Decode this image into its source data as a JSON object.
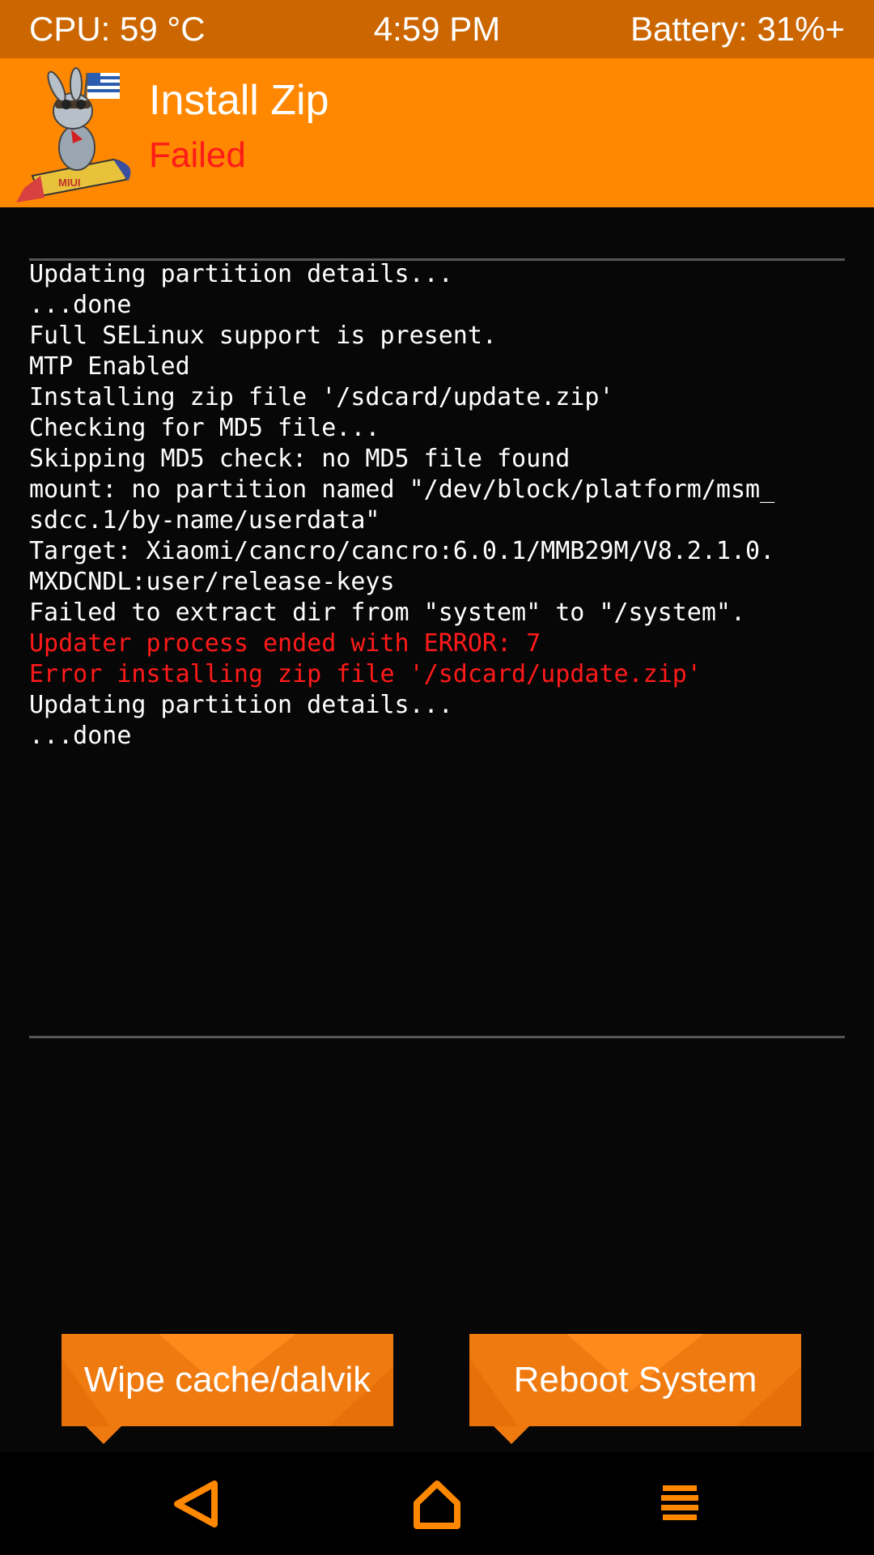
{
  "status_bar": {
    "cpu": "CPU: 59 °C",
    "time": "4:59 PM",
    "battery": "Battery: 31%+"
  },
  "header": {
    "logo_text": "MIUI",
    "title": "Install Zip",
    "subtitle": "Failed"
  },
  "console": {
    "lines": [
      {
        "text": "Updating partition details...",
        "error": false
      },
      {
        "text": "...done",
        "error": false
      },
      {
        "text": "Full SELinux support is present.",
        "error": false
      },
      {
        "text": "MTP Enabled",
        "error": false
      },
      {
        "text": "Installing zip file '/sdcard/update.zip'",
        "error": false
      },
      {
        "text": "Checking for MD5 file...",
        "error": false
      },
      {
        "text": "Skipping MD5 check: no MD5 file found",
        "error": false
      },
      {
        "text": "mount: no partition named \"/dev/block/platform/msm_",
        "error": false
      },
      {
        "text": "sdcc.1/by-name/userdata\"",
        "error": false
      },
      {
        "text": "Target: Xiaomi/cancro/cancro:6.0.1/MMB29M/V8.2.1.0.",
        "error": false
      },
      {
        "text": "MXDCNDL:user/release-keys",
        "error": false
      },
      {
        "text": "Failed to extract dir from \"system\" to \"/system\".",
        "error": false
      },
      {
        "text": "Updater process ended with ERROR: 7",
        "error": true
      },
      {
        "text": "Error installing zip file '/sdcard/update.zip'",
        "error": true
      },
      {
        "text": "Updating partition details...",
        "error": false
      },
      {
        "text": "...done",
        "error": false
      }
    ]
  },
  "buttons": {
    "wipe_label": "Wipe cache/dalvik",
    "reboot_label": "Reboot System"
  },
  "nav": {
    "back_icon": "back-triangle-icon",
    "home_icon": "home-icon",
    "menu_icon": "menu-icon"
  },
  "colors": {
    "status_bar": "#cc6600",
    "header": "#ff8800",
    "accent": "#ff8800",
    "error_text": "#ff1a1a",
    "button": "#ee7a10",
    "background": "#070707"
  }
}
